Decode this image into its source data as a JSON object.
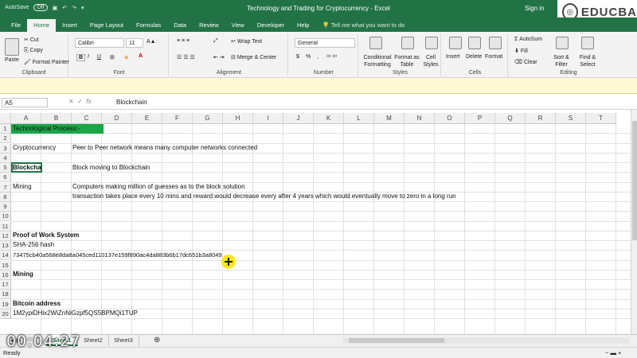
{
  "titlebar": {
    "autosave": "AutoSave",
    "autosave_state": "Off",
    "title": "Technology and Trading for Cryptocurrency  -  Excel",
    "signin": "Sign in"
  },
  "brand": {
    "name": "EDUCBA"
  },
  "tabs": [
    "File",
    "Home",
    "Insert",
    "Page Layout",
    "Formulas",
    "Data",
    "Review",
    "View",
    "Developer",
    "Help"
  ],
  "active_tab": "Home",
  "tell_me": "Tell me what you want to do",
  "ribbon": {
    "clipboard": {
      "label": "Clipboard",
      "paste": "Paste",
      "cut": "Cut",
      "copy": "Copy",
      "format_painter": "Format Painter"
    },
    "font": {
      "label": "Font",
      "name": "Calibri",
      "size": "11",
      "bold": "B",
      "italic": "I",
      "underline": "U"
    },
    "alignment": {
      "label": "Alignment",
      "wrap": "Wrap Text",
      "merge": "Merge & Center"
    },
    "number": {
      "label": "Number",
      "format": "General",
      "currency": "$",
      "percent": "%"
    },
    "styles": {
      "label": "Styles",
      "conditional": "Conditional Formatting",
      "format_table": "Format as Table",
      "cell_styles": "Cell Styles"
    },
    "cells": {
      "label": "Cells",
      "insert": "Insert",
      "delete": "Delete",
      "format": "Format"
    },
    "editing": {
      "label": "Editing",
      "autosum": "AutoSum",
      "fill": "Fill",
      "clear": "Clear",
      "sort": "Sort & Filter",
      "find": "Find & Select"
    }
  },
  "formula_bar": {
    "name_box": "A5",
    "fx": "fx",
    "formula": "Blockchain"
  },
  "columns": [
    "A",
    "B",
    "C",
    "D",
    "E",
    "F",
    "G",
    "H",
    "I",
    "J",
    "K",
    "L",
    "M",
    "N",
    "O",
    "P",
    "Q",
    "R",
    "S",
    "T"
  ],
  "rows": [
    "1",
    "2",
    "3",
    "4",
    "5",
    "6",
    "7",
    "8",
    "9",
    "10",
    "11",
    "12",
    "13",
    "14",
    "15",
    "16",
    "17",
    "18",
    "19",
    "20"
  ],
  "cells": {
    "r1": "Technological Process:-",
    "r3a": "Cryptocurrency",
    "r3c": "Peer to Peer network means many computer networks connected",
    "r5a": "Blockchain",
    "r5c": "Block moving to Blockchain",
    "r7a": "Mining",
    "r7c": "Computers making million of guesses as to the block solution",
    "r8c": "transaction takes place every 10 mins and reward would decrease every after 4 years which would eventually move to zero in a long run",
    "r12": "Proof of Work System",
    "r13": "SHA-256 hash",
    "r14": "73475cb40a568e8da8a045ced110137e159f890ac4da883b6b17dc651b3a8049",
    "r16": "Mining",
    "r19": "Bitcoin address",
    "r20": "1M2ypiDHix2WiZnNiGzpf5QS5BPMQi1TUP"
  },
  "sheet_tabs": [
    "Sheet1",
    "Sheet2",
    "Sheet3"
  ],
  "active_sheet": "Sheet1",
  "status": {
    "ready": "Ready"
  },
  "video_timer": "00:04:27",
  "colors": {
    "excel_green": "#217346",
    "title_fill": "#1aa547",
    "cursor": "#ffe600"
  }
}
